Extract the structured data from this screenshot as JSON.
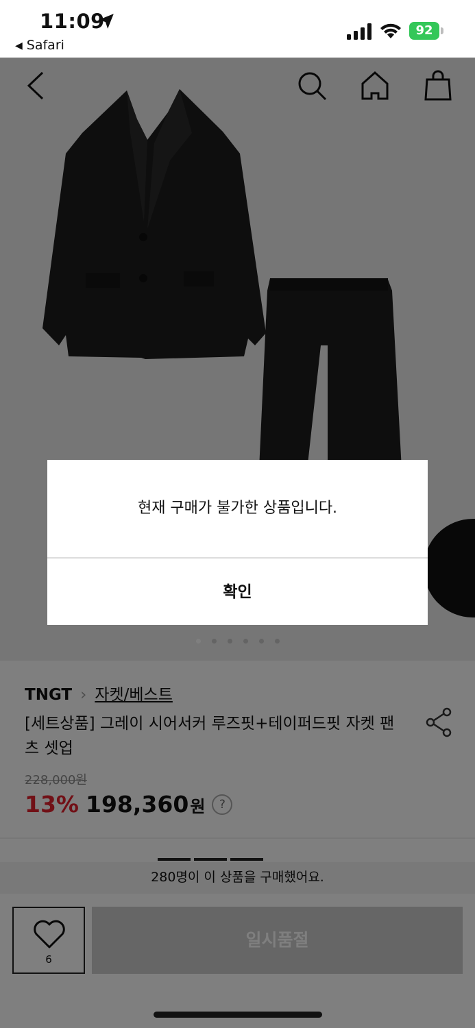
{
  "status_bar": {
    "time": "11:09",
    "back_app": "Safari",
    "battery": "92"
  },
  "nav": {
    "icons": [
      "back-icon",
      "search-icon",
      "home-icon",
      "shopping-bag-icon"
    ]
  },
  "product": {
    "brand": "TNGT",
    "category": "자켓/베스트",
    "title": "[세트상품] 그레이 시어서커 루즈핏+테이퍼드핏 자켓 팬츠 셋업",
    "original_price": "228,000원",
    "discount": "13%",
    "price": "198,360",
    "price_unit": "원",
    "help": "?"
  },
  "image_carousel": {
    "count": 6,
    "active_index": 0
  },
  "purchase_notice": "280명이 이 상품을 구매했어요.",
  "bottom_bar": {
    "like_count": "6",
    "soldout_label": "일시품절"
  },
  "modal": {
    "message": "현재 구매가 불가한 상품입니다.",
    "confirm_label": "확인"
  },
  "colors": {
    "accent_discount": "#e2202d",
    "battery": "#34c759",
    "overlay": "rgba(0,0,0,0.5)"
  }
}
